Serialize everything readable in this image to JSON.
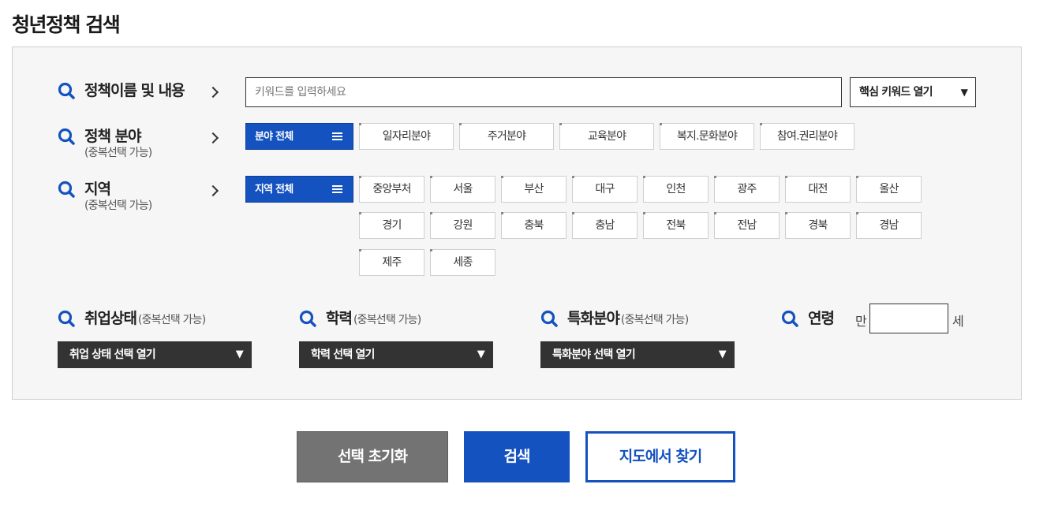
{
  "page_title": "청년정책 검색",
  "colors": {
    "accent": "#1452c0",
    "dark": "#333333",
    "reset": "#737373",
    "panel_bg": "#f6f6f6"
  },
  "icons": {
    "row_icon": "search-icon",
    "arrow": "chevron-right-icon"
  },
  "keyword": {
    "label": "정책이름 및 내용",
    "placeholder": "키워드를 입력하세요",
    "toggle_label": "핵심 키워드 열기",
    "toggle_arrow": "▼"
  },
  "field": {
    "label": "정책 분야",
    "sub": "(중복선택 가능)",
    "all_label": "분야 전체",
    "options": [
      "일자리분야",
      "주거분야",
      "교육분야",
      "복지.문화분야",
      "참여.권리분야"
    ]
  },
  "region": {
    "label": "지역",
    "sub": "(중복선택 가능)",
    "all_label": "지역 전체",
    "options": [
      "중앙부처",
      "서울",
      "부산",
      "대구",
      "인천",
      "광주",
      "대전",
      "울산",
      "경기",
      "강원",
      "충북",
      "충남",
      "전북",
      "전남",
      "경북",
      "경남",
      "제주",
      "세종"
    ]
  },
  "employment": {
    "label": "취업상태",
    "sub": "(중복선택 가능)",
    "select_label": "취업 상태 선택 열기",
    "arrow": "▼"
  },
  "education": {
    "label": "학력",
    "sub": "(중복선택 가능)",
    "select_label": "학력 선택 열기",
    "arrow": "▼"
  },
  "specialty": {
    "label": "특화분야",
    "sub": "(중복선택 가능)",
    "select_label": "특화분야 선택 열기",
    "arrow": "▼"
  },
  "age": {
    "label": "연령",
    "prefix": "만",
    "suffix": "세",
    "value": ""
  },
  "actions": {
    "reset": "선택 초기화",
    "search": "검색",
    "map": "지도에서 찾기"
  }
}
